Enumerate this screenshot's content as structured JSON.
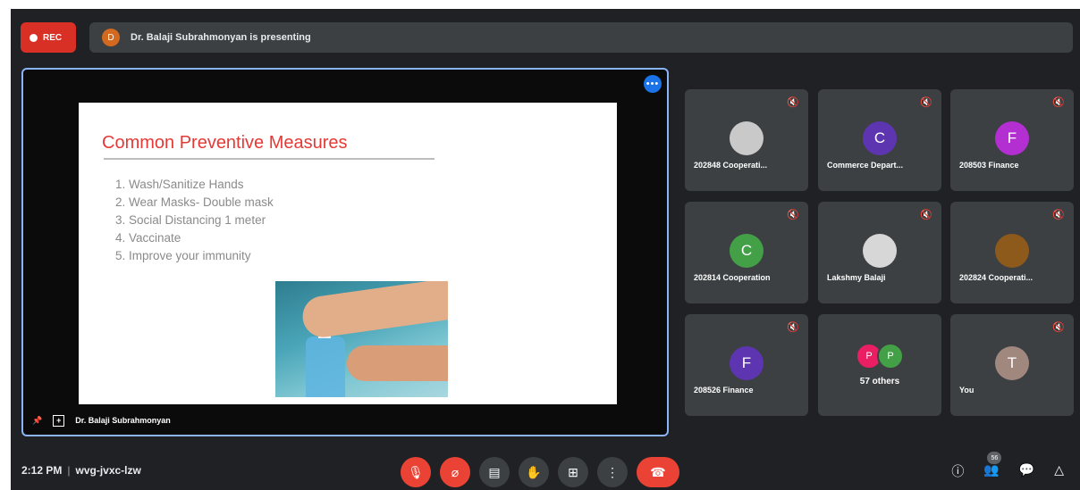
{
  "topbar": {
    "rec_label": "REC",
    "presenter_initial": "D",
    "presenting_text": "Dr. Balaji Subrahmonyan is presenting"
  },
  "slide": {
    "title": "Common Preventive Measures",
    "items": [
      "Wash/Sanitize Hands",
      "Wear Masks- Double mask",
      "Social Distancing 1 meter",
      "Vaccinate",
      "Improve your immunity"
    ]
  },
  "stage": {
    "more_icon": "•••",
    "presenter_name": "Dr. Balaji Subrahmonyan"
  },
  "participants": [
    {
      "name": "202848 Cooperati...",
      "initial": "",
      "color": "#c9c9c9"
    },
    {
      "name": "Commerce Depart...",
      "initial": "C",
      "color": "#5e35b1"
    },
    {
      "name": "208503 Finance",
      "initial": "F",
      "color": "#b32fd1"
    },
    {
      "name": "202814 Cooperation",
      "initial": "C",
      "color": "#43a047"
    },
    {
      "name": "Lakshmy Balaji",
      "initial": "",
      "color": "#d7d7d7"
    },
    {
      "name": "202824 Cooperati...",
      "initial": "",
      "color": "#8d5a1c"
    },
    {
      "name": "208526 Finance",
      "initial": "F",
      "color": "#5e35b1"
    },
    {
      "name": "You",
      "initial": "T",
      "color": "#a1887f"
    }
  ],
  "others": {
    "initials": [
      "P",
      "P"
    ],
    "colors": [
      "#e91e63",
      "#43a047"
    ],
    "label": "57 others"
  },
  "bottombar": {
    "time": "2:12 PM",
    "meeting_code": "wvg-jvxc-lzw",
    "participant_count": "56"
  }
}
